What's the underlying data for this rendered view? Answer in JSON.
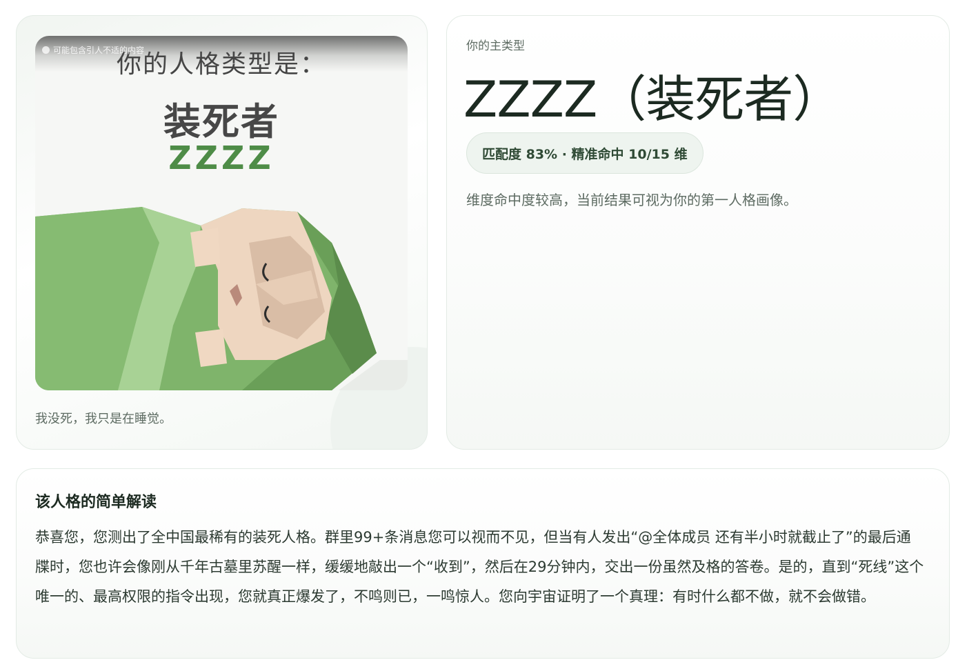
{
  "image_card": {
    "notice": "可能包含引人不适的内容",
    "poster": {
      "heading": "你的人格类型是：",
      "type_name": "装死者",
      "code": "ZZZZ"
    },
    "caption": "我没死，我只是在睡觉。"
  },
  "type_card": {
    "kicker": "你的主类型",
    "title": "ZZZZ（装死者）",
    "match_pill": "匹配度 83% · 精准命中 10/15 维",
    "note": "维度命中度较高，当前结果可视为你的第一人格画像。"
  },
  "description_card": {
    "title": "该人格的简单解读",
    "body": "恭喜您，您测出了全中国最稀有的装死人格。群里99+条消息您可以视而不见，但当有人发出“@全体成员 还有半小时就截止了”的最后通牒时，您也许会像刚从千年古墓里苏醒一样，缓缓地敲出一个“收到”，然后在29分钟内，交出一份虽然及格的答卷。是的，直到“死线”这个唯一的、最高权限的指令出现，您就真正爆发了，不鸣则已，一鸣惊人。您向宇宙证明了一个真理：有时什么都不做，就不会做错。"
  },
  "colors": {
    "accent_green": "#4e8c47",
    "pill_bg": "#eef4ef",
    "text_dark": "#1c2a21",
    "text_muted": "#5d6b62"
  }
}
